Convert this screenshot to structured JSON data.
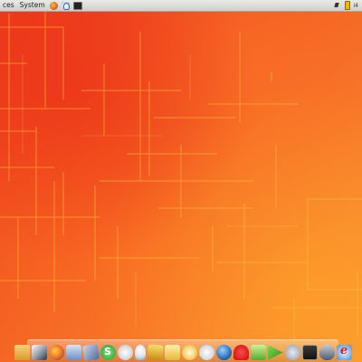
{
  "top_panel": {
    "menu_places": "ces",
    "menu_system": "System",
    "launchers": [
      "firefox-icon",
      "help-icon",
      "terminal-icon"
    ],
    "tray": [
      "network-icon",
      "battery-icon"
    ],
    "clock": "i4"
  },
  "dock": {
    "icons": [
      "home-folder-icon",
      "display-icon",
      "firefox-icon",
      "mail-icon",
      "text-editor-icon",
      "skype-icon",
      "gimp-icon",
      "lightbulb-icon",
      "notes-icon",
      "sticky-notes-icon",
      "clock-icon",
      "chat-icon",
      "globe-icon",
      "game-icon",
      "music-icon",
      "media-player-icon",
      "settings-icon",
      "video-icon",
      "security-icon",
      "ie-icon"
    ]
  },
  "colors": {
    "wallpaper_primary": "#f25a1c",
    "wallpaper_accent": "#fb9a33",
    "wallpaper_lines": "#ffc23a",
    "panel_bg": "#e0e0dc"
  }
}
